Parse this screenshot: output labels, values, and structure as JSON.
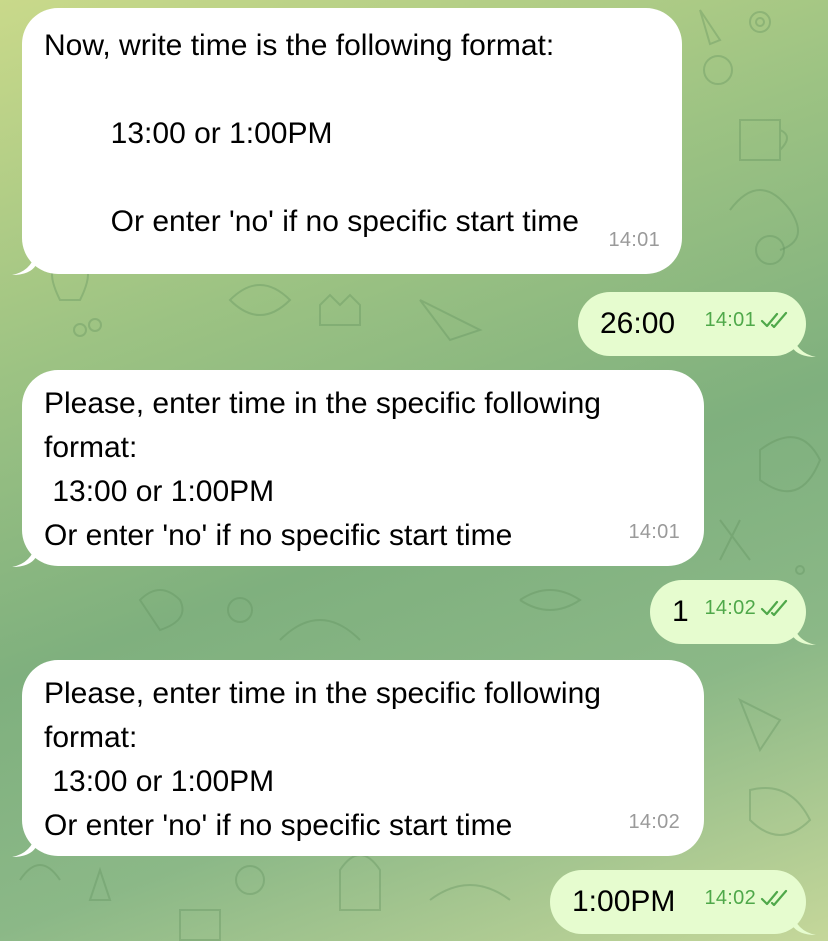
{
  "messages": [
    {
      "direction": "incoming",
      "lines": [
        "Now, write time is the following format:",
        "",
        "        13:00 or 1:00PM",
        "",
        "        Or enter 'no' if no specific start time"
      ],
      "time": "14:01"
    },
    {
      "direction": "outgoing",
      "text": "26:00",
      "time": "14:01",
      "status": "double-check-icon"
    },
    {
      "direction": "incoming",
      "lines": [
        "Please, enter time in the specific following",
        "format:",
        " 13:00 or 1:00PM",
        "Or enter 'no' if no specific start time"
      ],
      "time": "14:01"
    },
    {
      "direction": "outgoing",
      "text": "1",
      "time": "14:02",
      "status": "double-check-icon"
    },
    {
      "direction": "incoming",
      "lines": [
        "Please, enter time in the specific following",
        "format:",
        " 13:00 or 1:00PM",
        "Or enter 'no' if no specific start time"
      ],
      "time": "14:02"
    },
    {
      "direction": "outgoing",
      "text": "1:00PM",
      "time": "14:02",
      "status": "double-check-icon"
    }
  ],
  "colors": {
    "incoming_bubble": "#ffffff",
    "outgoing_bubble": "#e6fccf",
    "outgoing_time": "#4fa84a",
    "incoming_time": "#9a9a9a"
  }
}
